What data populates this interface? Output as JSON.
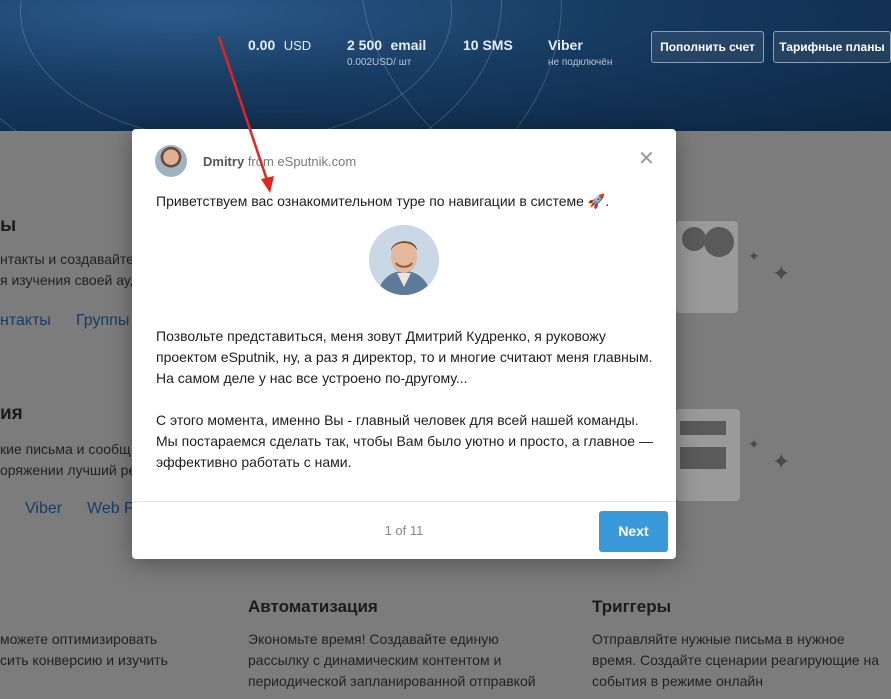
{
  "header": {
    "balance": {
      "value": "0.00",
      "unit": "USD"
    },
    "email": {
      "value": "2 500",
      "unit": "email",
      "sub": "0.002USD/ шт"
    },
    "sms": {
      "value": "10 SMS"
    },
    "viber": {
      "value": "Viber",
      "sub": "не подключён"
    },
    "topup_button": "Пополнить счет",
    "plans_button": "Тарифные планы"
  },
  "background": {
    "section1_title": "ы",
    "section1_line1": "нтакты и создавайте",
    "section1_line2": "я изучения своей ау,",
    "section1_link1": "нтакты",
    "section1_link2": "Группы",
    "section2_title": "ия",
    "section2_line1": "кие письма и сообщ",
    "section2_line2": "оряжении лучший ре",
    "section2_link1": "Viber",
    "section2_link2": "Web P",
    "col1_line1": "можете оптимизировать",
    "col1_line2": "сить конверсию и изучить",
    "automation_title": "Автоматизация",
    "automation_text1": "Экономьте время! Создавайте единую",
    "automation_text2": "рассылку с динамическим контентом и",
    "automation_text3": "периодической запланированной отправкой",
    "triggers_title": "Триггеры",
    "triggers_text1": "Отправляйте нужные письма в нужное",
    "triggers_text2": "время. Создайте сценарии реагирующие на",
    "triggers_text3": "события в режиме онлайн"
  },
  "modal": {
    "sender_name": "Dmitry",
    "sender_from": "from eSputnik.com",
    "intro": "Приветствуем вас ознакомительном туре по навигации в системе 🚀.",
    "para1_line1": "Позвольте представиться, меня зовут Дмитрий Кудренко, я руковожу",
    "para1_line2": "проектом eSputnik, ну, а раз я директор, то и многие считают меня главным.",
    "para1_line3": "На самом деле у нас все устроено по-другому...",
    "para2_line1": "С этого момента, именно Вы - главный человек для всей нашей команды.",
    "para2_line2": "Мы постараемся сделать так, чтобы Вам было уютно и просто, а главное —",
    "para2_line3": "эффективно работать с нами.",
    "counter": "1 of 11",
    "next_button": "Next"
  },
  "icons": {
    "close": "close-icon",
    "arrow": "annotation-arrow"
  },
  "colors": {
    "accent": "#3a9ad9",
    "header": "#163a60",
    "arrow": "#e8231f"
  }
}
